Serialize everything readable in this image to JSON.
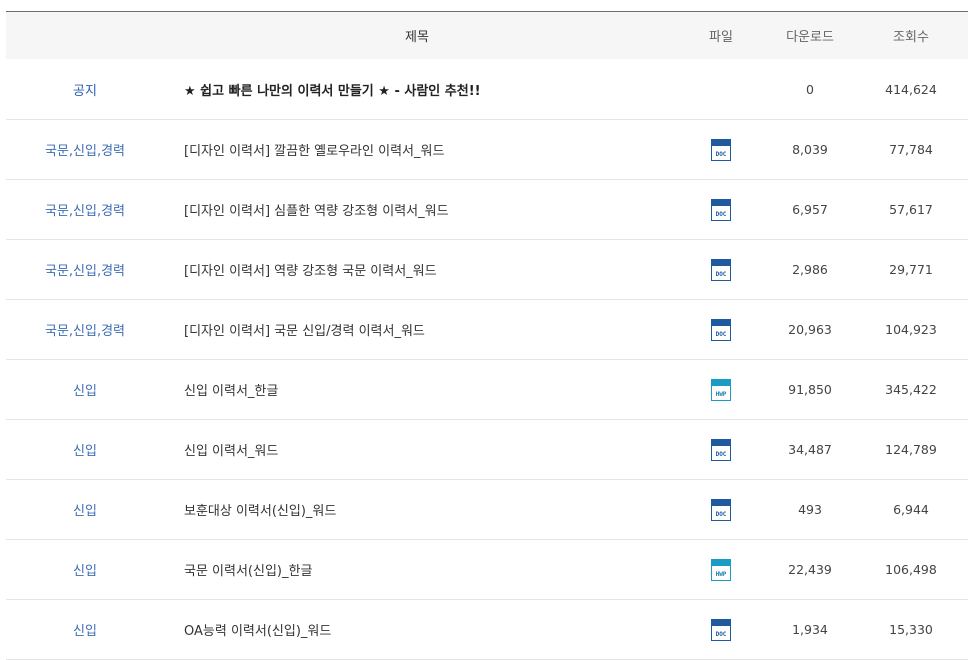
{
  "header": {
    "title": "제목",
    "file": "파일",
    "downloads": "다운로드",
    "views": "조회수"
  },
  "rows": [
    {
      "category": "공지",
      "title": "★ 쉽고 빠른 나만의 이력서 만들기 ★ - 사람인 추천!!",
      "file": "",
      "downloads": "0",
      "views": "414,624"
    },
    {
      "category": "국문,신입,경력",
      "title": "[디자인 이력서] 깔끔한 옐로우라인 이력서_워드",
      "file": "DOC",
      "downloads": "8,039",
      "views": "77,784"
    },
    {
      "category": "국문,신입,경력",
      "title": "[디자인 이력서] 심플한 역량 강조형 이력서_워드",
      "file": "DOC",
      "downloads": "6,957",
      "views": "57,617"
    },
    {
      "category": "국문,신입,경력",
      "title": "[디자인 이력서] 역량 강조형 국문 이력서_워드",
      "file": "DOC",
      "downloads": "2,986",
      "views": "29,771"
    },
    {
      "category": "국문,신입,경력",
      "title": "[디자인 이력서] 국문 신입/경력 이력서_워드",
      "file": "DOC",
      "downloads": "20,963",
      "views": "104,923"
    },
    {
      "category": "신입",
      "title": "신입 이력서_한글",
      "file": "HWP",
      "downloads": "91,850",
      "views": "345,422"
    },
    {
      "category": "신입",
      "title": "신입 이력서_워드",
      "file": "DOC",
      "downloads": "34,487",
      "views": "124,789"
    },
    {
      "category": "신입",
      "title": "보훈대상 이력서(신입)_워드",
      "file": "DOC",
      "downloads": "493",
      "views": "6,944"
    },
    {
      "category": "신입",
      "title": "국문 이력서(신입)_한글",
      "file": "HWP",
      "downloads": "22,439",
      "views": "106,498"
    },
    {
      "category": "신입",
      "title": "OA능력 이력서(신입)_워드",
      "file": "DOC",
      "downloads": "1,934",
      "views": "15,330"
    }
  ],
  "colors": {
    "category": "#3d6db5",
    "doc_icon": "#1f5aa0",
    "hwp_icon": "#1b9cc4",
    "header_bg": "#f6f6f6"
  }
}
